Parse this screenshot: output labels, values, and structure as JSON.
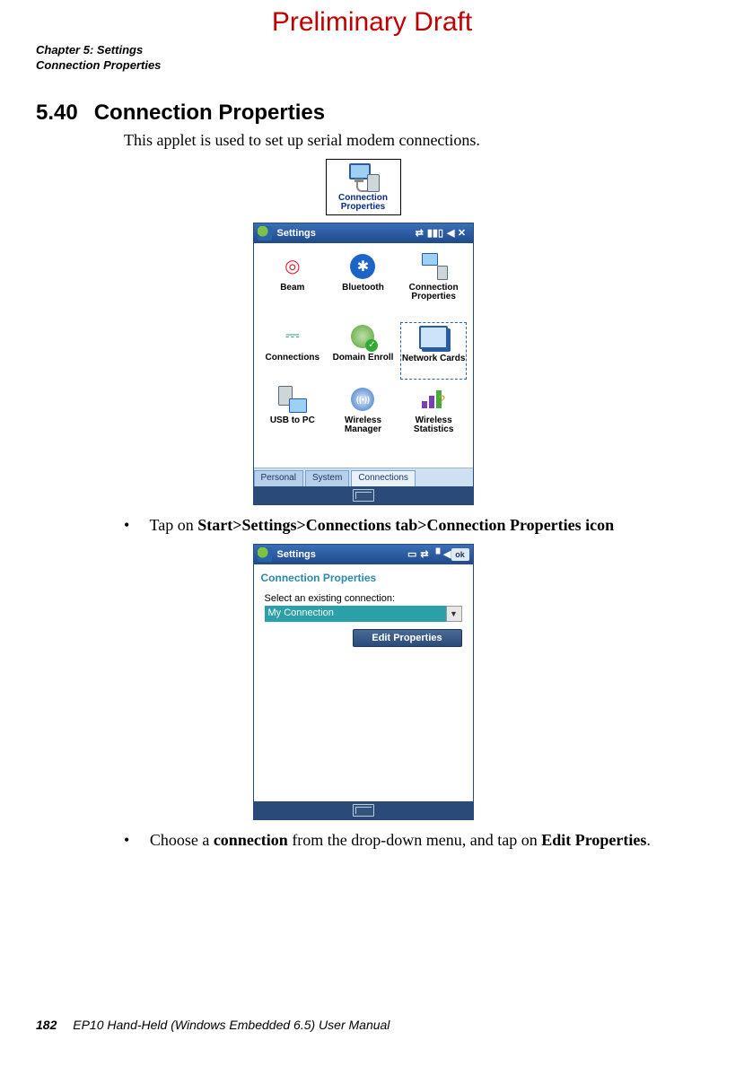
{
  "watermark": "Preliminary Draft",
  "header": {
    "chapter": "Chapter 5: Settings",
    "section": "Connection Properties"
  },
  "section_number": "5.40",
  "section_title": "Connection Properties",
  "intro_text": "This applet is used to set up serial modem connections.",
  "icon_tile_label": "Connection Properties",
  "settings_panel": {
    "title": "Settings",
    "tabs": {
      "personal": "Personal",
      "system": "System",
      "connections": "Connections"
    },
    "items": [
      {
        "label": "Beam"
      },
      {
        "label": "Bluetooth"
      },
      {
        "label": "Connection Properties"
      },
      {
        "label": "Connections"
      },
      {
        "label": "Domain Enroll"
      },
      {
        "label": "Network Cards"
      },
      {
        "label": "USB to PC"
      },
      {
        "label": "Wireless Manager"
      },
      {
        "label": "Wireless Statistics"
      }
    ]
  },
  "bullet1_prefix": "Tap on ",
  "bullet1_bold": "Start>Settings>Connections tab>Connection Properties icon",
  "dialog": {
    "titlebar": "Settings",
    "ok": "ok",
    "heading": "Connection Properties",
    "select_label": "Select an existing connection:",
    "select_value": "My Connection",
    "button": "Edit Properties"
  },
  "bullet2_pre": "Choose a ",
  "bullet2_bold1": "connection",
  "bullet2_mid": " from the drop-down menu, and tap on ",
  "bullet2_bold2": "Edit Properties",
  "bullet2_post": ".",
  "footer": {
    "page": "182",
    "title": "EP10 Hand-Held (Windows Embedded 6.5) User Manual"
  }
}
